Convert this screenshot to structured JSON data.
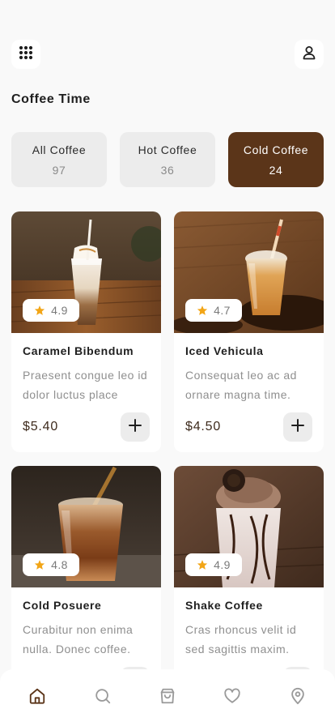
{
  "app": {
    "title": "Coffee Time"
  },
  "header": {
    "menu_icon": "grid-dots-icon",
    "profile_icon": "user-icon"
  },
  "categories": [
    {
      "label": "All Coffee",
      "count": "97",
      "active": false
    },
    {
      "label": "Hot Coffee",
      "count": "36",
      "active": false
    },
    {
      "label": "Cold Coffee",
      "count": "24",
      "active": true
    }
  ],
  "products": [
    {
      "name": "Caramel Bibendum",
      "description": "Praesent congue leo id dolor luctus place",
      "price": "$5.40",
      "rating": "4.9"
    },
    {
      "name": "Iced Vehicula",
      "description": "Consequat leo ac ad ornare magna time.",
      "price": "$4.50",
      "rating": "4.7"
    },
    {
      "name": "Cold Posuere",
      "description": "Curabitur non enima nulla. Donec coffee.",
      "price": "",
      "rating": "4.8"
    },
    {
      "name": "Shake Coffee",
      "description": "Cras rhoncus velit id sed sagittis maxim.",
      "price": "",
      "rating": "4.9"
    }
  ],
  "bottom_nav": [
    {
      "icon": "home-icon",
      "active": true
    },
    {
      "icon": "search-icon",
      "active": false
    },
    {
      "icon": "shopping-bag-icon",
      "active": false
    },
    {
      "icon": "heart-icon",
      "active": false
    },
    {
      "icon": "location-pin-icon",
      "active": false
    }
  ],
  "colors": {
    "accent": "#5b3519",
    "background": "#f9f9f9",
    "card": "#ffffff",
    "chip": "#ececec",
    "star": "#f2a516",
    "muted_text": "#8f8f8f"
  }
}
